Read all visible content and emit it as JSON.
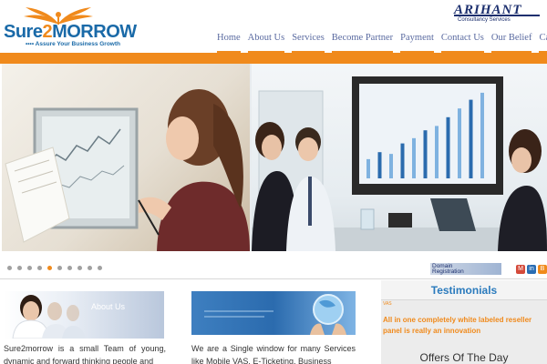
{
  "header": {
    "logo": {
      "name_part1": "Sure",
      "name_part2": "2",
      "name_part3": "MORROW",
      "tagline": "Assure Your Business Growth"
    },
    "partner": {
      "name": "ARIHANT",
      "subtitle": "Consultancy Services"
    },
    "nav": [
      {
        "label": "Home"
      },
      {
        "label": "About Us"
      },
      {
        "label": "Services"
      },
      {
        "label": "Become Partner"
      },
      {
        "label": "Payment"
      },
      {
        "label": "Contact Us"
      },
      {
        "label": "Our Belief"
      },
      {
        "label": "Careers"
      }
    ]
  },
  "slider": {
    "dot_count": 10,
    "active_dot": 4,
    "chart_bars": [
      0.22,
      0.3,
      0.28,
      0.4,
      0.46,
      0.55,
      0.6,
      0.7,
      0.8,
      0.9,
      0.98
    ]
  },
  "domain_registration": {
    "line1": "Domain",
    "line2": "Registration"
  },
  "social_icons": [
    "gmail-icon",
    "linkedin-icon",
    "blogger-icon"
  ],
  "about": {
    "banner_title": "About Us",
    "text": "Sure2morrow is a small Team of young, dynamic and forward thinking people and"
  },
  "window_section": {
    "text": "We are a Single window for many Services like Mobile VAS, E-Ticketing, Business"
  },
  "testimonials": {
    "title": "Testimonials",
    "small_label": "VAS",
    "quote": "All in one completely white labeled reseller panel is really an innovation"
  },
  "offers": {
    "title": "Offers Of The Day"
  },
  "colors": {
    "accent": "#f08a1c",
    "brand_blue": "#1a6aa8",
    "nav_text": "#5a6aa0",
    "testimonial_blue": "#2b7bbd"
  }
}
